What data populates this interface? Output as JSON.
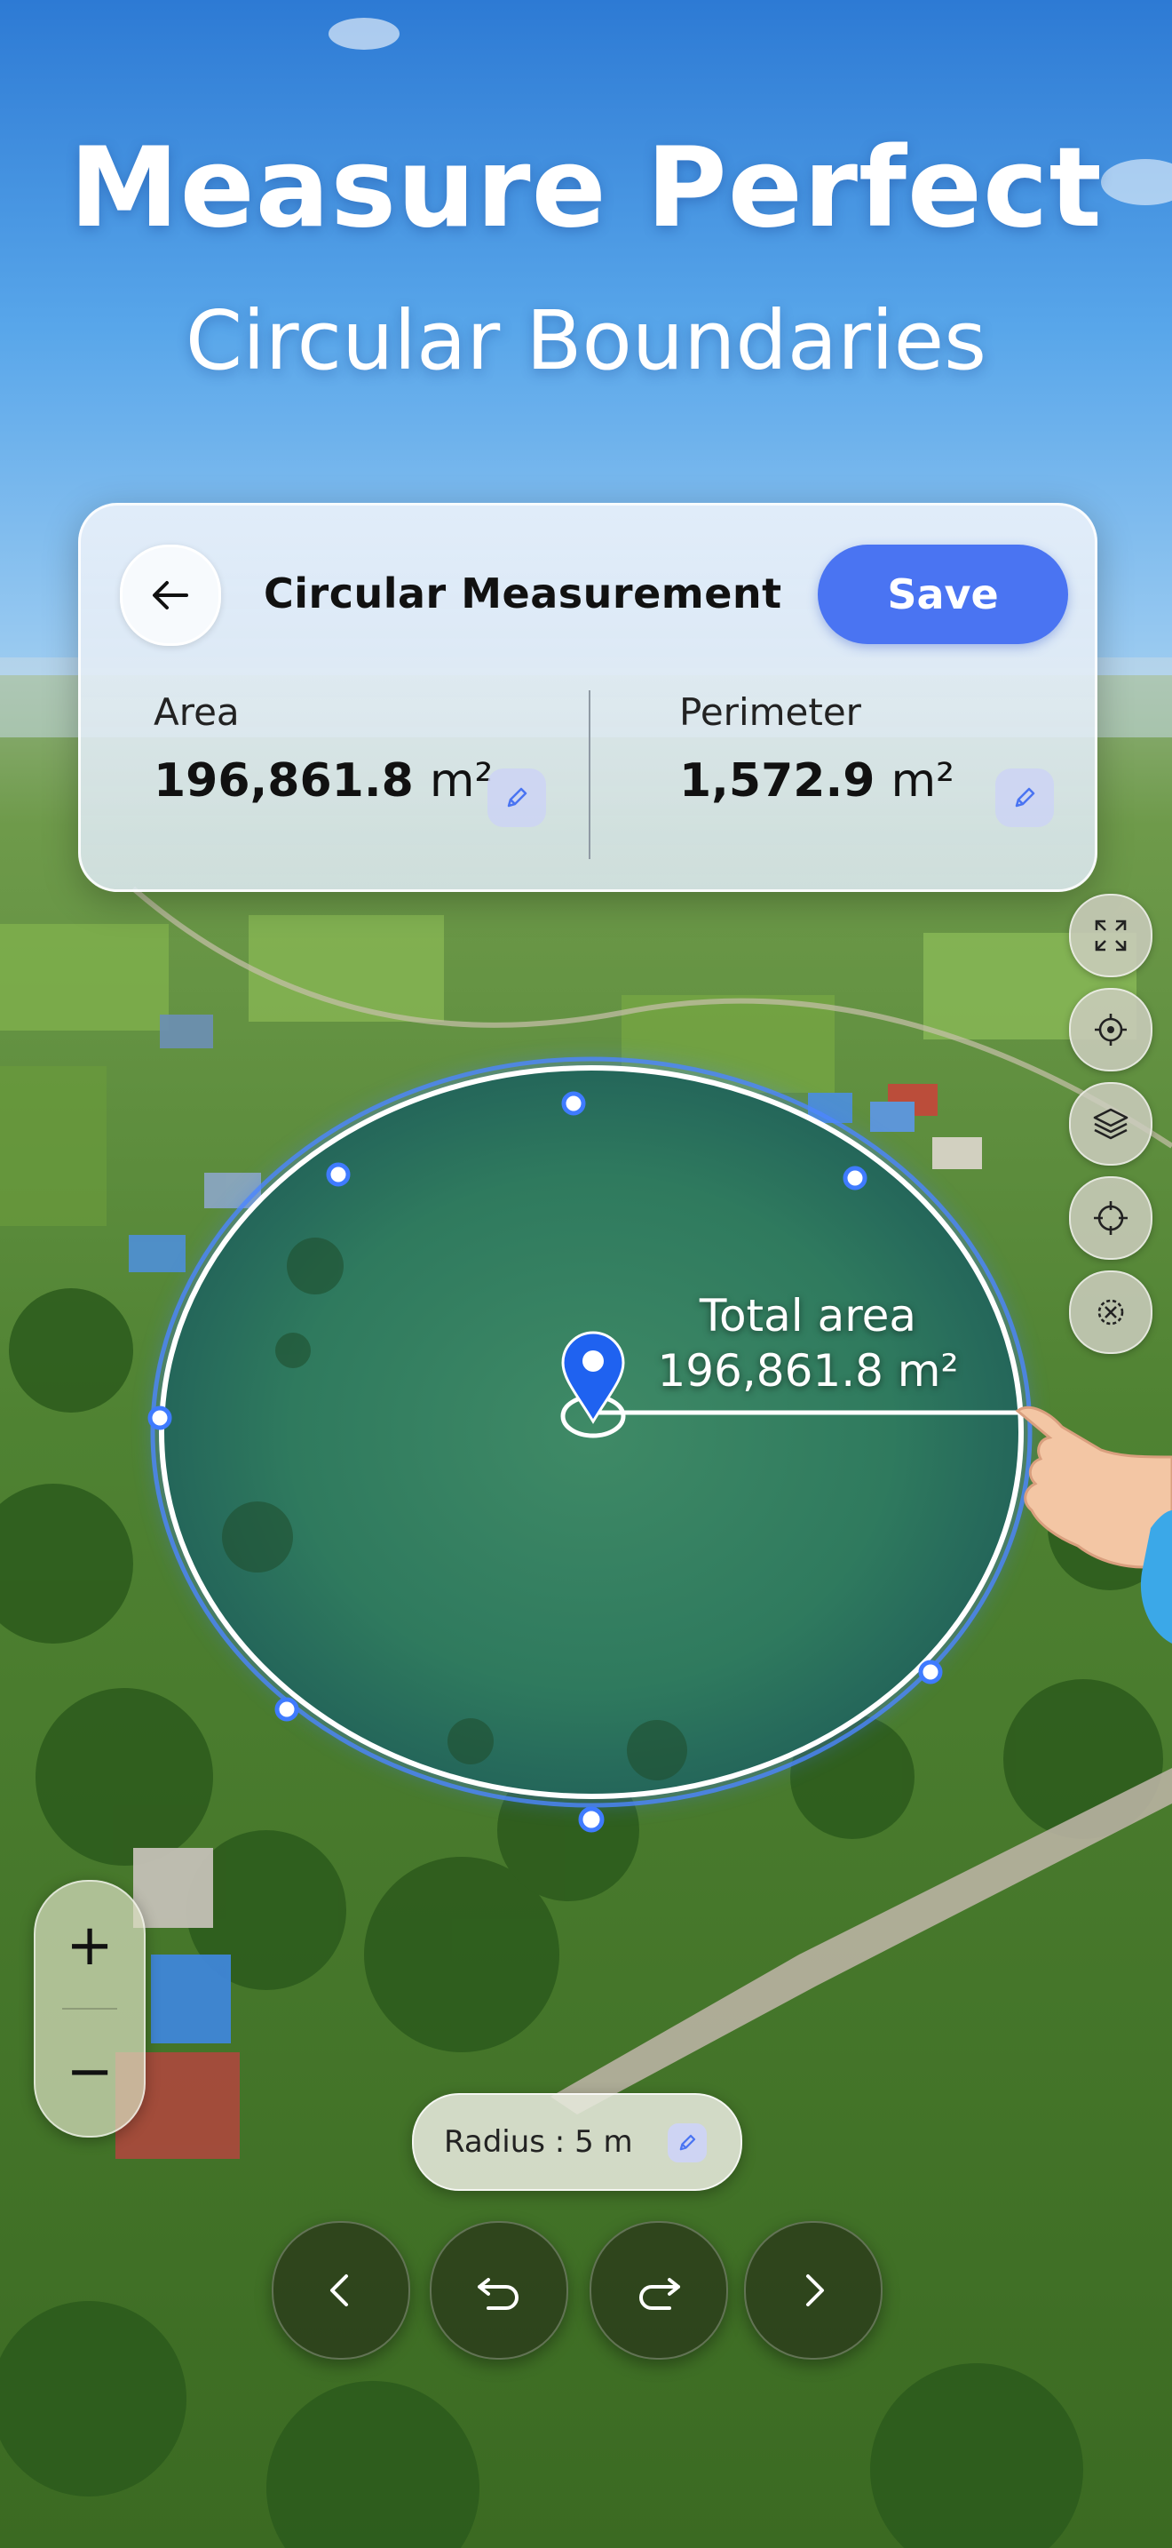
{
  "headline": {
    "title": "Measure Perfect",
    "subtitle": "Circular Boundaries"
  },
  "card": {
    "title": "Circular Measurement",
    "save_label": "Save",
    "area": {
      "label": "Area",
      "value": "196,861.8",
      "unit": "m²"
    },
    "perimeter": {
      "label": "Perimeter",
      "value": "1,572.9",
      "unit": "m²"
    }
  },
  "map": {
    "total_area_label": "Total area",
    "total_area_value": "196,861.8 m²"
  },
  "radius": {
    "text": "Radius : 5 m"
  },
  "zoom": {
    "plus": "+",
    "minus": "−"
  },
  "side_buttons": [
    "expand-icon",
    "target-icon",
    "layers-icon",
    "crosshair-icon",
    "location-off-icon"
  ],
  "nav": [
    "chevron-left-icon",
    "undo-icon",
    "redo-icon",
    "chevron-right-icon"
  ],
  "colors": {
    "accent": "#4a74f2",
    "circle": "#3f7bff",
    "sky_top": "#2f7fd6"
  }
}
